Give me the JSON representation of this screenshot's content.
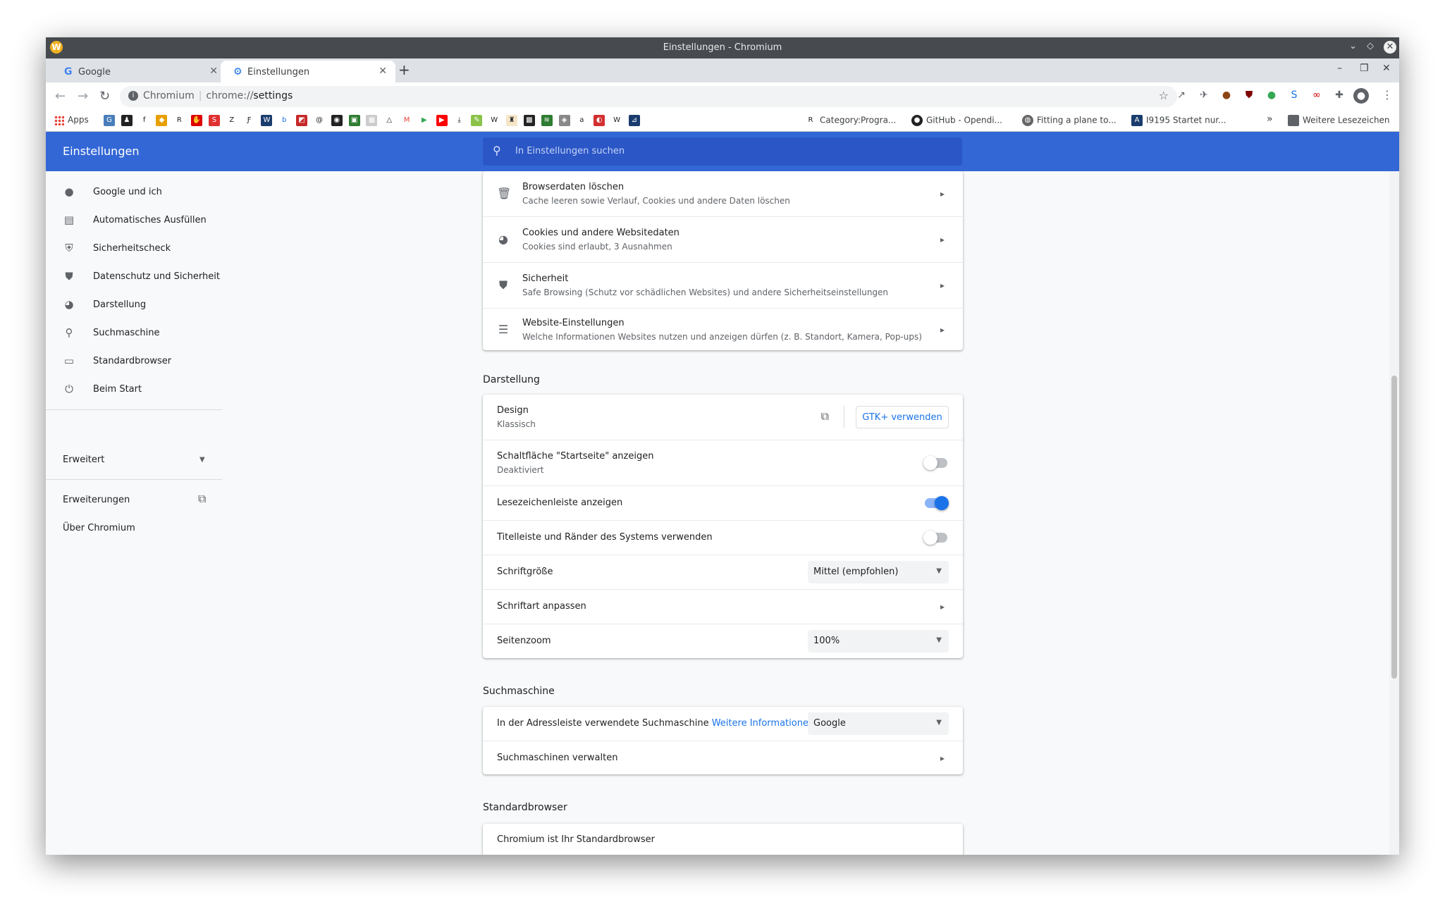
{
  "window": {
    "title": "Einstellungen - Chromium",
    "app_icon_letter": "W"
  },
  "tabs": [
    {
      "label": "Google",
      "favicon": "G",
      "active": false
    },
    {
      "label": "Einstellungen",
      "favicon": "⚙",
      "active": true
    }
  ],
  "omnibox": {
    "site": "Chromium",
    "url_prefix": "chrome://",
    "url_path": "settings"
  },
  "bookmarks": {
    "apps_label": "Apps",
    "items": [
      {
        "label": "Category:Progra..."
      },
      {
        "label": "GitHub - Opendi..."
      },
      {
        "label": "Fitting a plane to..."
      },
      {
        "label": "I9195 Startet nur..."
      }
    ],
    "more_label": "»",
    "other_label": "Weitere Lesezeichen"
  },
  "header": {
    "title": "Einstellungen",
    "search_placeholder": "In Einstellungen suchen"
  },
  "sidebar": {
    "items": [
      {
        "label": "Google und ich",
        "icon": "person-icon"
      },
      {
        "label": "Automatisches Ausfüllen",
        "icon": "clipboard-icon"
      },
      {
        "label": "Sicherheitscheck",
        "icon": "shield-check-icon"
      },
      {
        "label": "Datenschutz und Sicherheit",
        "icon": "shield-icon"
      },
      {
        "label": "Darstellung",
        "icon": "palette-icon"
      },
      {
        "label": "Suchmaschine",
        "icon": "search-icon"
      },
      {
        "label": "Standardbrowser",
        "icon": "browser-icon"
      },
      {
        "label": "Beim Start",
        "icon": "power-icon"
      }
    ],
    "advanced_label": "Erweitert",
    "extensions_label": "Erweiterungen",
    "about_label": "Über Chromium"
  },
  "privacy_rows": [
    {
      "title": "Browserdaten löschen",
      "subtitle": "Cache leeren sowie Verlauf, Cookies und andere Daten löschen",
      "icon": "trash-icon"
    },
    {
      "title": "Cookies und andere Websitedaten",
      "subtitle": "Cookies sind erlaubt, 3 Ausnahmen",
      "icon": "cookie-icon"
    },
    {
      "title": "Sicherheit",
      "subtitle": "Safe Browsing (Schutz vor schädlichen Websites) und andere Sicherheitseinstellungen",
      "icon": "shield-icon"
    },
    {
      "title": "Website-Einstellungen",
      "subtitle": "Welche Informationen Websites nutzen und anzeigen dürfen (z. B. Standort, Kamera, Pop-ups)",
      "icon": "sliders-icon"
    }
  ],
  "appearance": {
    "section_title": "Darstellung",
    "design_title": "Design",
    "design_sub": "Klassisch",
    "gtk_button": "GTK+ verwenden",
    "home_button_title": "Schaltfläche \"Startseite\" anzeigen",
    "home_button_sub": "Deaktiviert",
    "home_button_on": false,
    "bookmarks_bar_title": "Lesezeichenleiste anzeigen",
    "bookmarks_bar_on": true,
    "system_titlebar_title": "Titelleiste und Ränder des Systems verwenden",
    "system_titlebar_on": false,
    "font_size_title": "Schriftgröße",
    "font_size_value": "Mittel (empfohlen)",
    "customize_fonts_title": "Schriftart anpassen",
    "page_zoom_title": "Seitenzoom",
    "page_zoom_value": "100%"
  },
  "search_engine": {
    "section_title": "Suchmaschine",
    "row_title": "In der Adressleiste verwendete Suchmaschine",
    "more_info_link": "Weitere Informationen",
    "value": "Google",
    "manage_title": "Suchmaschinen verwalten"
  },
  "default_browser": {
    "section_title": "Standardbrowser",
    "status": "Chromium ist Ihr Standardbrowser"
  },
  "colors": {
    "header_blue": "#3367d6",
    "accent": "#1a73e8",
    "titlebar": "#474b50"
  }
}
